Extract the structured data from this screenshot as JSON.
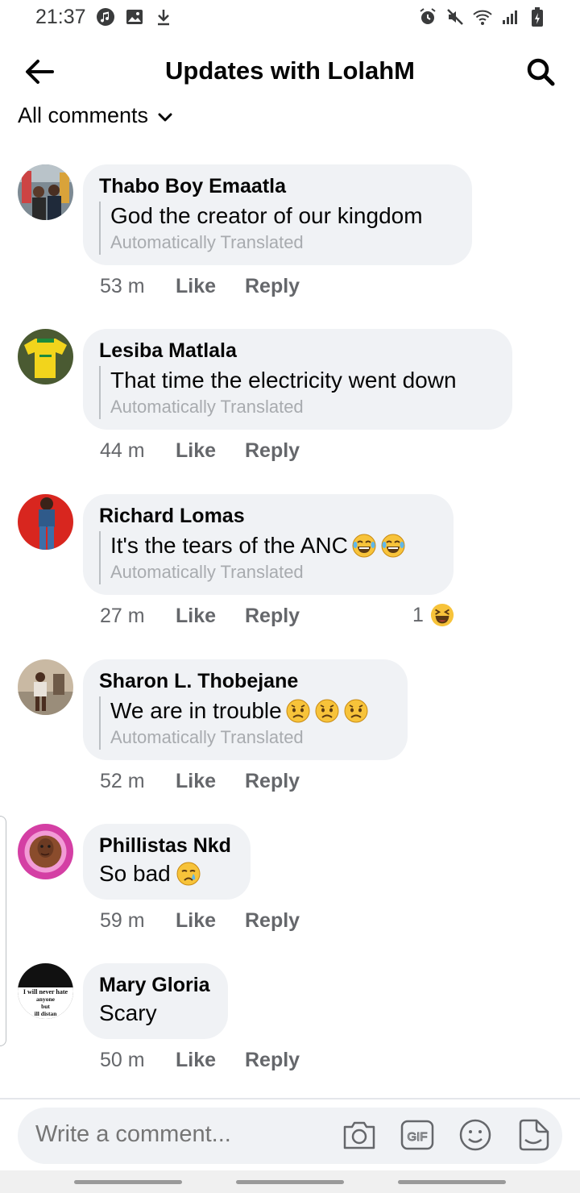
{
  "status_bar": {
    "time": "21:37",
    "left_icons": [
      "music-icon",
      "image-icon",
      "download-icon"
    ],
    "right_icons": [
      "alarm-icon",
      "mute-icon",
      "wifi-icon",
      "signal-icon",
      "battery-icon"
    ]
  },
  "header": {
    "title": "Updates with LolahM",
    "back_icon": "back-arrow-icon",
    "search_icon": "search-icon"
  },
  "filter": {
    "label": "All comments"
  },
  "comments": [
    {
      "author": "Thabo Boy Emaatla",
      "text": "God the creator of our kingdom",
      "note": "Automatically Translated",
      "time": "53 m",
      "like": "Like",
      "reply": "Reply"
    },
    {
      "author": "Lesiba Matlala",
      "text": "That time the electricity went down",
      "note": "Automatically Translated",
      "time": "44 m",
      "like": "Like",
      "reply": "Reply"
    },
    {
      "author": "Richard Lomas",
      "text": "It's the tears of the ANC",
      "note": "Automatically Translated",
      "time": "27 m",
      "like": "Like",
      "reply": "Reply",
      "reaction_count": "1"
    },
    {
      "author": "Sharon L. Thobejane",
      "text": "We are in trouble",
      "note": "Automatically Translated",
      "time": "52 m",
      "like": "Like",
      "reply": "Reply"
    },
    {
      "author": "Phillistas Nkd",
      "text": "So bad",
      "time": "59 m",
      "like": "Like",
      "reply": "Reply"
    },
    {
      "author": "Mary Gloria",
      "text": "Scary",
      "time": "50 m",
      "like": "Like",
      "reply": "Reply",
      "avatar_text": [
        "I will never hate",
        "anyone",
        "but",
        "ill distan"
      ]
    }
  ],
  "composer": {
    "placeholder": "Write a comment...",
    "icons": [
      "camera-icon",
      "gif-icon",
      "emoji-icon",
      "sticker-icon"
    ]
  },
  "colors": {
    "bubble": "#f0f2f5",
    "meta": "#65676b",
    "translated_note": "#a8abaf"
  }
}
